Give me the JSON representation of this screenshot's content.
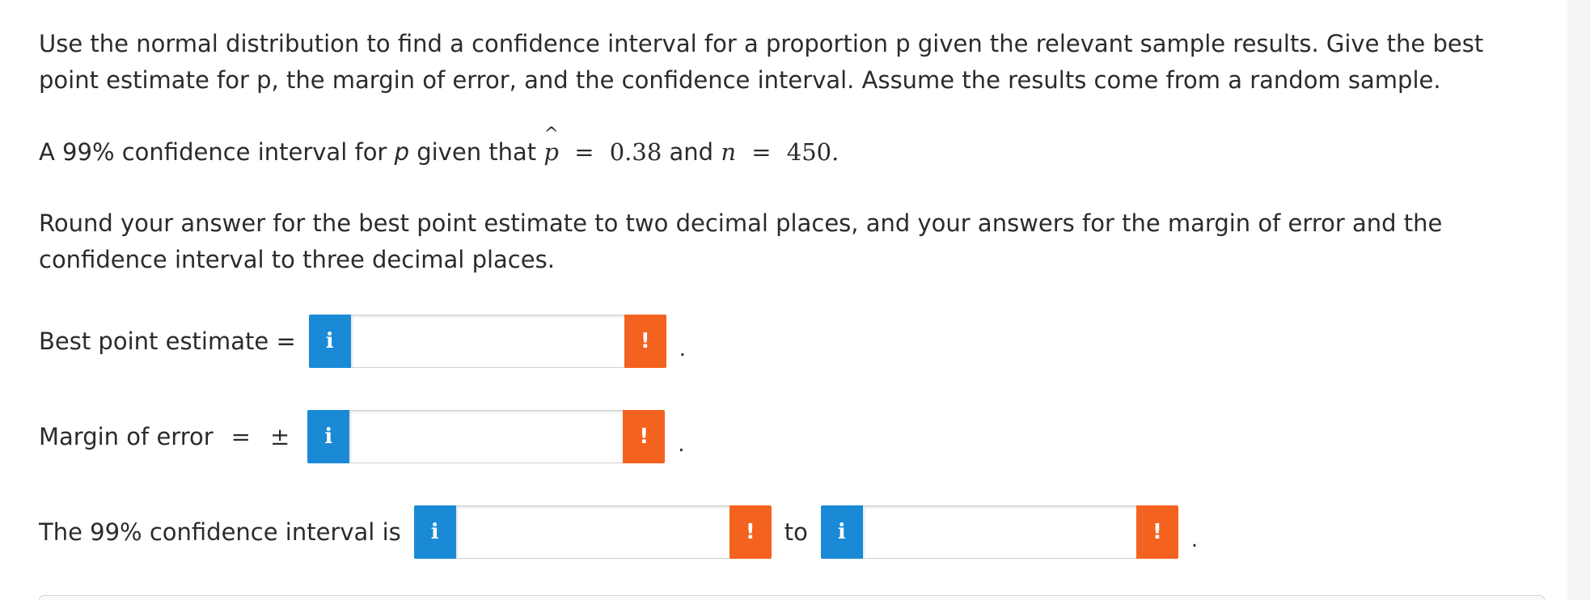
{
  "intro": {
    "text": "Use the normal distribution to find a confidence interval for a proportion p given the relevant sample results. Give the best point estimate for p, the margin of error, and the confidence interval. Assume the results come from a random sample."
  },
  "problem": {
    "prefix": "A 99% confidence interval for",
    "p": "p",
    "given": "given that",
    "phat_symbol": "p",
    "hat": "^",
    "eq": "=",
    "phat_value": "0.38",
    "and": "and",
    "n_symbol": "n",
    "n_value": "450."
  },
  "rounding": {
    "text": "Round your answer for the best point estimate to two decimal places, and your answers for the margin of error and the confidence interval to three decimal places."
  },
  "best_point": {
    "label": "Best point estimate =",
    "info": "i",
    "alert": "!",
    "value": "",
    "period": "."
  },
  "margin": {
    "label": "Margin of error",
    "eq": "=",
    "pm": "±",
    "info": "i",
    "alert": "!",
    "value": "",
    "period": "."
  },
  "interval": {
    "label": "The 99% confidence interval is",
    "to": "to",
    "info": "i",
    "alert": "!",
    "lower_value": "",
    "upper_value": "",
    "period": "."
  },
  "colors": {
    "info": "#1a8ad7",
    "alert": "#f4621f",
    "text": "#2b2b2b"
  }
}
